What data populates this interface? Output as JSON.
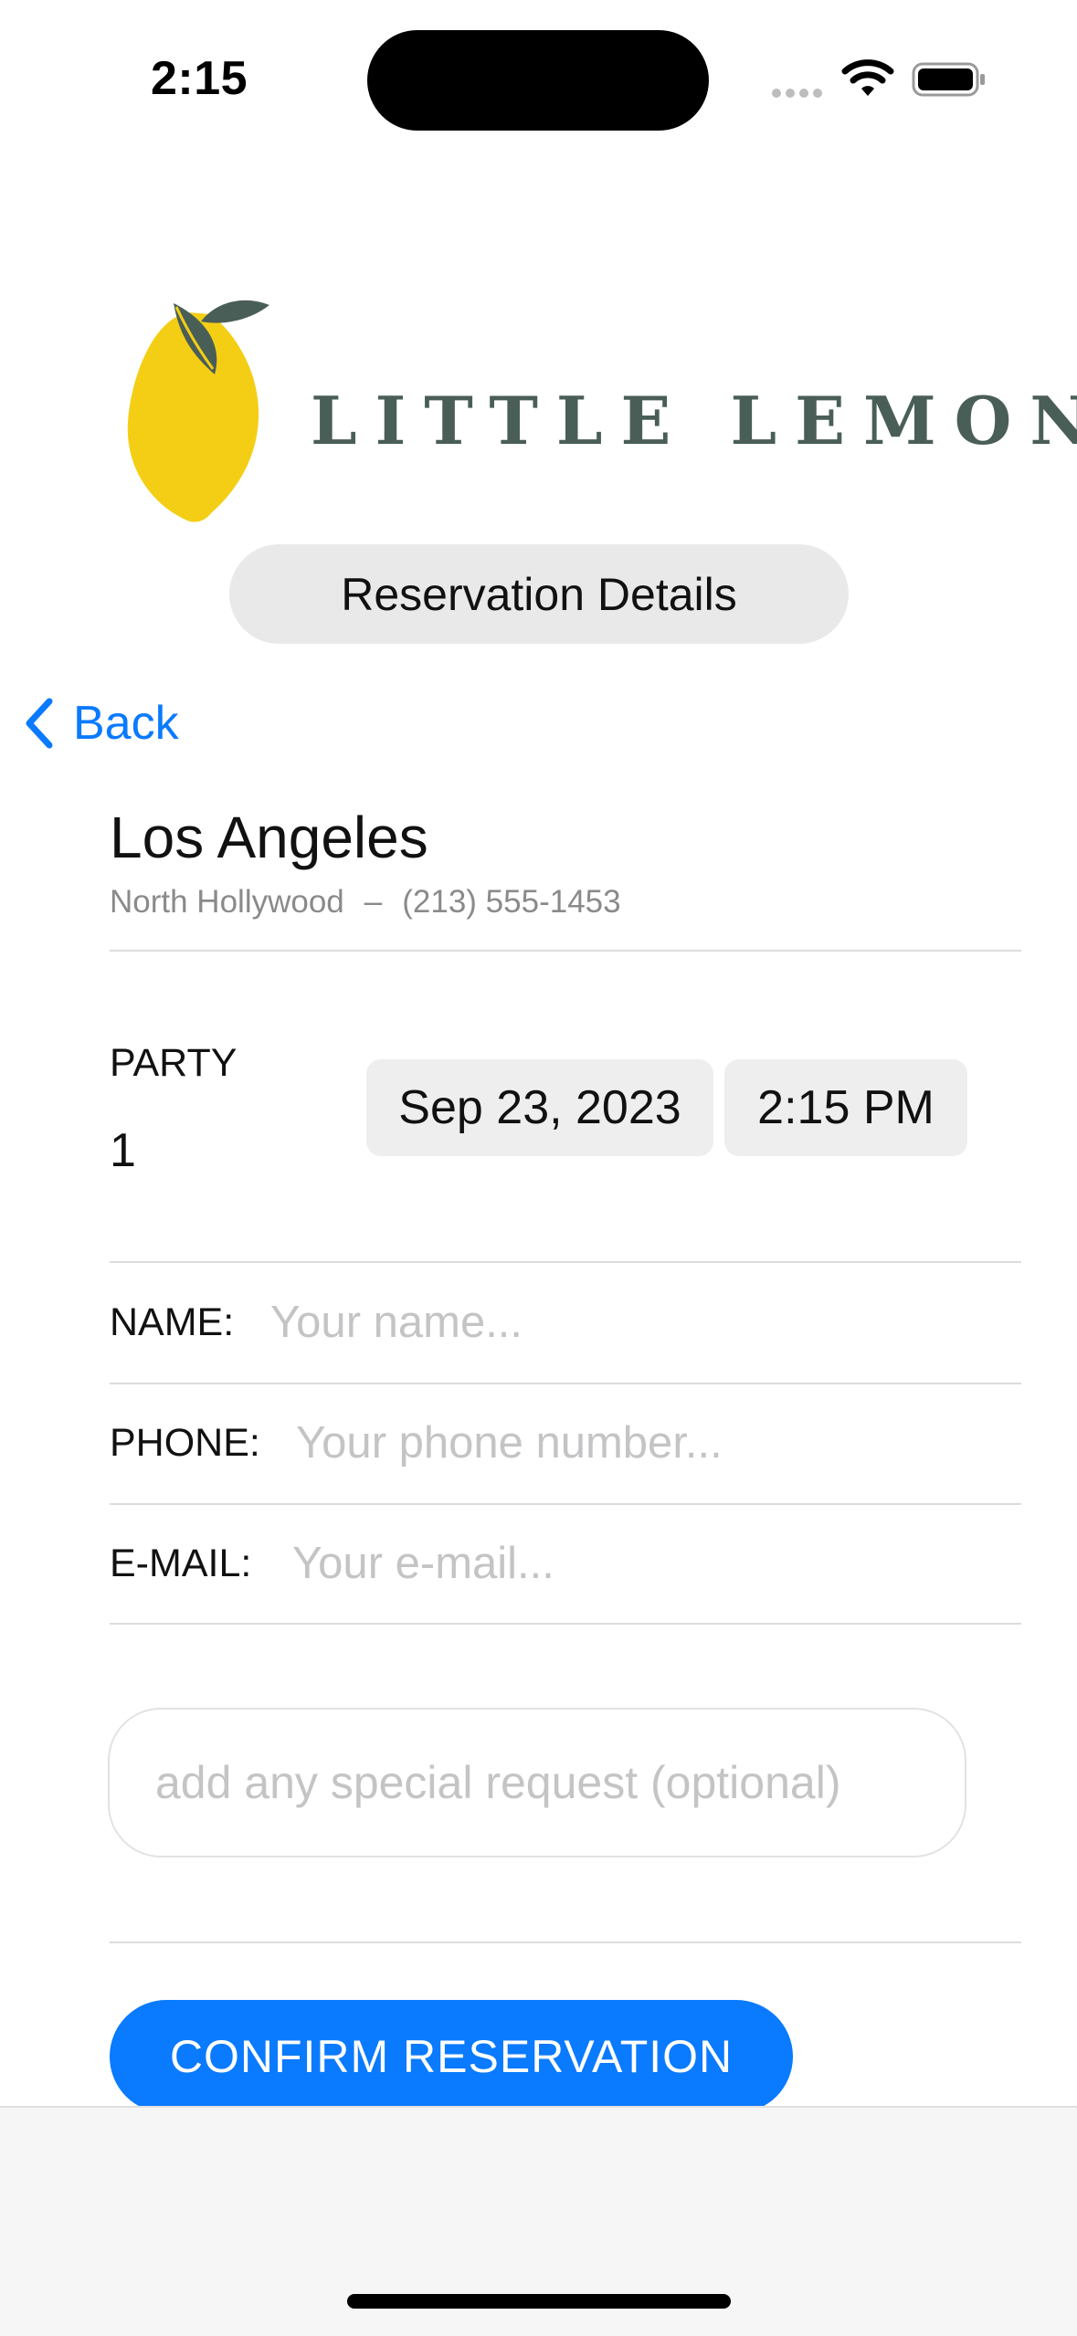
{
  "status_bar": {
    "time": "2:15"
  },
  "brand": {
    "name": "LITTLE LEMON",
    "color": "#495e57",
    "lemon_color": "#f4ce14",
    "leaf_color": "#495e57"
  },
  "header": {
    "title": "Reservation Details"
  },
  "nav": {
    "back_label": "Back",
    "accent": "#0a7aff"
  },
  "location": {
    "city": "Los Angeles",
    "neighborhood": "North Hollywood",
    "separator": "–",
    "phone": "(213) 555-1453"
  },
  "reservation": {
    "party_label": "PARTY",
    "party_size": "1",
    "date": "Sep 23, 2023",
    "time": "2:15 PM"
  },
  "form": {
    "name": {
      "label": "NAME:",
      "placeholder": "Your name..."
    },
    "phone": {
      "label": "PHONE:",
      "placeholder": "Your phone number..."
    },
    "email": {
      "label": "E-MAIL:",
      "placeholder": "Your e-mail..."
    },
    "special_request": {
      "placeholder": "add any special request (optional)"
    }
  },
  "actions": {
    "confirm_label": "CONFIRM RESERVATION"
  }
}
